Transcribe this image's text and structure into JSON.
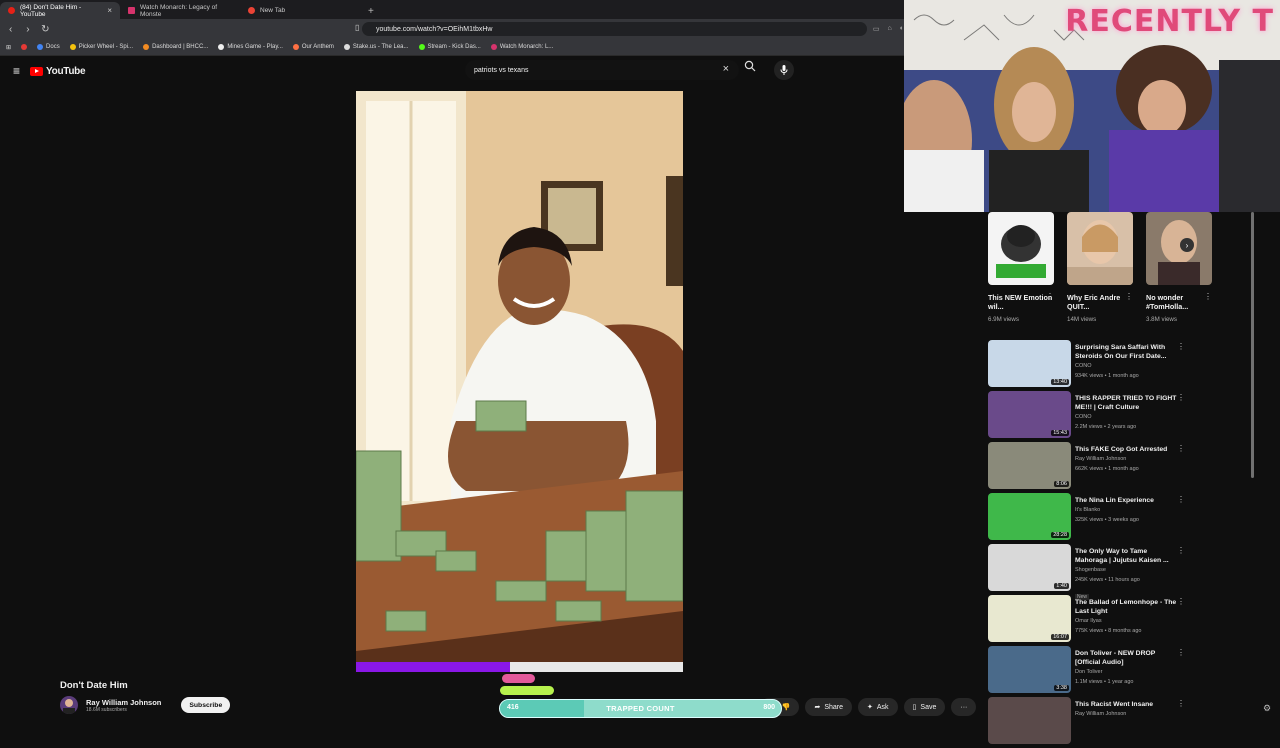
{
  "browser": {
    "tabs": [
      {
        "title": "(84) Don't Date Him - YouTube",
        "active": true
      },
      {
        "title": "Watch Monarch: Legacy of Monste",
        "active": false
      },
      {
        "title": "New Tab",
        "active": false
      }
    ],
    "url": "youtube.com/watch?v=OEihM1tbxHw",
    "bookmarks": [
      "Docs",
      "Picker Wheel - Spi...",
      "Dashboard | BHCC...",
      "Mines Game - Play...",
      "Our Anthem",
      "Stake.us - The Lea...",
      "Stream - Kick Das...",
      "Watch Monarch: L..."
    ]
  },
  "youtube": {
    "logo": "YouTube",
    "search_value": "patriots vs texans"
  },
  "webcam": {
    "banner": "RECENTLY T"
  },
  "video": {
    "title": "Don't Date Him",
    "channel": "Ray William Johnson",
    "subscribers": "18.6M subscribers",
    "subscribe_label": "Subscribe",
    "actions": {
      "share": "Share",
      "ask": "Ask",
      "save": "Save"
    }
  },
  "overlay": {
    "count": "416",
    "label": "TRAPPED COUNT",
    "goal": "800",
    "progress": 0.3
  },
  "shorts": [
    {
      "title": "This NEW Emotion wil...",
      "views": "6.9M views"
    },
    {
      "title": "Why Eric Andre QUIT...",
      "views": "14M views"
    },
    {
      "title": "No wonder #TomHolla...",
      "views": "3.8M views"
    }
  ],
  "recommendations": [
    {
      "title": "Surprising Sara Saffari With Steroids On Our First Date...",
      "channel": "CONO",
      "stats": "934K views • 1 month ago",
      "duration": "13:40",
      "badge": "",
      "color": "#c8d8e8"
    },
    {
      "title": "THIS RAPPER TRIED TO FIGHT ME!!! | Craft Culture",
      "channel": "CONO",
      "stats": "2.2M views • 2 years ago",
      "duration": "15:43",
      "badge": "",
      "color": "#6a4a8a"
    },
    {
      "title": "This FAKE Cop Got Arrested",
      "channel": "Ray William Johnson",
      "stats": "662K views • 1 month ago",
      "duration": "8:06",
      "badge": "",
      "color": "#8a8a7a"
    },
    {
      "title": "The Nina Lin Experience",
      "channel": "It's Blanko",
      "stats": "325K views • 3 weeks ago",
      "duration": "28:28",
      "badge": "",
      "color": "#3fb84a"
    },
    {
      "title": "The Only Way to Tame Mahoraga | Jujutsu Kaisen ...",
      "channel": "Shogenbase",
      "stats": "245K views • 11 hours ago",
      "duration": "1:40",
      "badge": "New",
      "color": "#d9d9d9"
    },
    {
      "title": "The Ballad of Lemonhope - The Last Light",
      "channel": "Omar Ilyas",
      "stats": "775K views • 8 months ago",
      "duration": "16:07",
      "badge": "",
      "color": "#e8e8d0"
    },
    {
      "title": "Don Toliver - NEW DROP [Official Audio]",
      "channel": "Don Toliver",
      "stats": "1.1M views • 1 year ago",
      "duration": "3:38",
      "badge": "",
      "color": "#4a6a8a"
    },
    {
      "title": "This Racist Went Insane",
      "channel": "Ray William Johnson",
      "stats": "",
      "duration": "",
      "badge": "",
      "color": "#5a4a4a"
    }
  ]
}
